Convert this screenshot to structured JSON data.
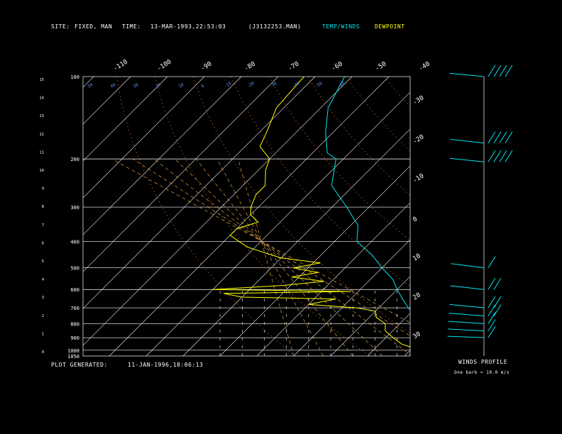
{
  "header": {
    "site_label": "SITE:",
    "site_value": "FIXED, MAN",
    "time_label": "TIME:",
    "time_value": "13-MAR-1993,22:53:03",
    "file_value": "(J3132253.MAN)",
    "temp_legend": "TEMP/WINDS",
    "dewpoint_legend": "DEWPOINT"
  },
  "footer": {
    "generated_label": "PLOT GENERATED:",
    "generated_value": "11-JAN-1996,18:06:13",
    "winds_title": "WINDS PROFILE",
    "winds_note": "One barb = 10.0 m/s"
  },
  "colors": {
    "temperature": "#00e5ee",
    "dewpoint": "#ffff00",
    "grid": "#ffffff",
    "dry_adiabat": "#d2691e",
    "moist_adiabat": "#e0a040",
    "mixing_ratio": "#e08040",
    "wind_barb": "#00e5ee"
  },
  "chart_data": {
    "type": "line",
    "pressure_levels": [
      400,
      300,
      200,
      500,
      600,
      700,
      800,
      900,
      1000,
      1050
    ],
    "pressure_labels": [
      "100",
      "200",
      "300",
      "400",
      "500",
      "600",
      "700",
      "800",
      "900",
      "1000",
      "1050"
    ],
    "height_labels": [
      "15",
      "14",
      "13",
      "12",
      "11",
      "10",
      "9",
      "8",
      "7",
      "6",
      "5",
      "4",
      "3",
      "2",
      "1",
      "0"
    ],
    "top_temp_labels": [
      "-110",
      "-100",
      "-90",
      "-80",
      "-70",
      "-60",
      "-50",
      "-40"
    ],
    "right_temp_labels": [
      "-30",
      "-20",
      "-10",
      "0",
      "10",
      "20",
      "30"
    ],
    "potential_temp_labels": [
      "50",
      "40",
      "30",
      "20",
      "10",
      "0",
      "-10",
      "-20",
      "-30",
      "-40",
      "-50",
      "-60"
    ],
    "series": [
      {
        "name": "TEMP/WINDS",
        "points": [
          [
            -82,
            100
          ],
          [
            -78,
            130
          ],
          [
            -72,
            160
          ],
          [
            -66,
            190
          ],
          [
            -62,
            200
          ],
          [
            -56,
            250
          ],
          [
            -46,
            300
          ],
          [
            -38,
            350
          ],
          [
            -34,
            400
          ],
          [
            -26,
            450
          ],
          [
            -20,
            500
          ],
          [
            -14,
            550
          ],
          [
            -10,
            600
          ],
          [
            -6,
            650
          ],
          [
            -2,
            700
          ],
          [
            2,
            750
          ],
          [
            4,
            800
          ],
          [
            8,
            850
          ],
          [
            10,
            900
          ],
          [
            12,
            950
          ],
          [
            14,
            1000
          ],
          [
            15,
            1020
          ]
        ]
      },
      {
        "name": "DEWPOINT",
        "points": [
          [
            -93,
            100
          ],
          [
            -92,
            130
          ],
          [
            -88,
            160
          ],
          [
            -86,
            180
          ],
          [
            -80,
            200
          ],
          [
            -78,
            220
          ],
          [
            -74,
            250
          ],
          [
            -74,
            270
          ],
          [
            -72,
            300
          ],
          [
            -70,
            320
          ],
          [
            -66,
            340
          ],
          [
            -70,
            360
          ],
          [
            -70,
            380
          ],
          [
            -66,
            400
          ],
          [
            -62,
            420
          ],
          [
            -56,
            440
          ],
          [
            -50,
            460
          ],
          [
            -38,
            480
          ],
          [
            -44,
            500
          ],
          [
            -36,
            520
          ],
          [
            -42,
            540
          ],
          [
            -32,
            560
          ],
          [
            -42,
            580
          ],
          [
            -60,
            600
          ],
          [
            -22,
            610
          ],
          [
            -56,
            620
          ],
          [
            -50,
            640
          ],
          [
            -24,
            650
          ],
          [
            -30,
            680
          ],
          [
            -16,
            700
          ],
          [
            -10,
            720
          ],
          [
            -8,
            760
          ],
          [
            -4,
            800
          ],
          [
            -2,
            850
          ],
          [
            2,
            900
          ],
          [
            6,
            950
          ],
          [
            10,
            980
          ],
          [
            12,
            1000
          ]
        ]
      }
    ],
    "wind_barbs": [
      {
        "pressure": 100,
        "direction": 250,
        "speed_ms": 40
      },
      {
        "pressure": 175,
        "direction": 260,
        "speed_ms": 40
      },
      {
        "pressure": 205,
        "direction": 255,
        "speed_ms": 35
      },
      {
        "pressure": 500,
        "direction": 270,
        "speed_ms": 5
      },
      {
        "pressure": 600,
        "direction": 260,
        "speed_ms": 20
      },
      {
        "pressure": 700,
        "direction": 250,
        "speed_ms": 20
      },
      {
        "pressure": 750,
        "direction": 240,
        "speed_ms": 15
      },
      {
        "pressure": 800,
        "direction": 230,
        "speed_ms": 10
      },
      {
        "pressure": 850,
        "direction": 220,
        "speed_ms": 10
      },
      {
        "pressure": 900,
        "direction": 210,
        "speed_ms": 10
      }
    ]
  }
}
